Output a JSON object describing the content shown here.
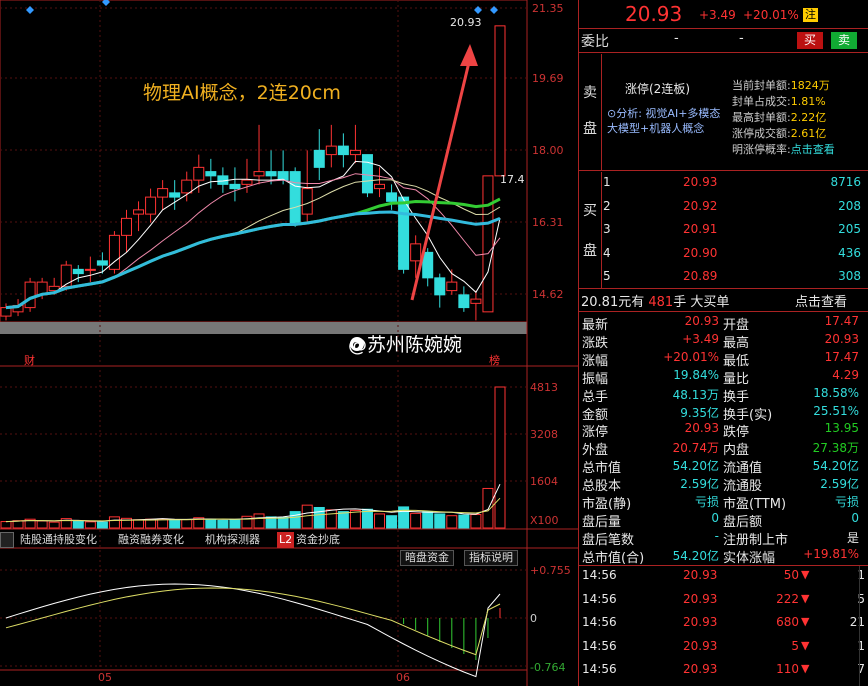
{
  "chart": {
    "price_labels": [
      "21.35",
      "19.69",
      "18.00",
      "16.31",
      "14.62"
    ],
    "high_marker": "20.93",
    "low_marker": "17.4",
    "annotation": "物理AI概念，2连20cm",
    "watermark": "@苏州陈婉婉",
    "marker_left": "财",
    "marker_right": "榜",
    "volume_labels": [
      "4813",
      "3208",
      "1604",
      "X100"
    ],
    "macd_labels": [
      "+0.755",
      "0",
      "-0.764"
    ],
    "month_labels": [
      "05",
      "06"
    ],
    "tabs": [
      "陆股通持股变化",
      "融资融券变化",
      "机构探测器",
      "资金抄底"
    ],
    "tab_badge": "L2",
    "buttons": [
      "暗盘资金",
      "指标说明"
    ],
    "colors": {
      "up": "#ff3333",
      "down": "#33dddd",
      "ma_green": "#33cc33",
      "ma_cyan": "#33bbdd",
      "ma_white": "#dddddd",
      "ma_pink": "#ee88aa"
    },
    "candles": [
      {
        "o": 14.1,
        "c": 14.3,
        "h": 14.4,
        "l": 14.0,
        "v": 220
      },
      {
        "o": 14.2,
        "c": 14.35,
        "h": 14.5,
        "l": 14.1,
        "v": 250
      },
      {
        "o": 14.3,
        "c": 14.9,
        "h": 15.0,
        "l": 14.2,
        "v": 300
      },
      {
        "o": 14.6,
        "c": 14.9,
        "h": 15.0,
        "l": 14.5,
        "v": 240
      },
      {
        "o": 14.7,
        "c": 14.8,
        "h": 15.0,
        "l": 14.6,
        "v": 200
      },
      {
        "o": 14.8,
        "c": 15.3,
        "h": 15.4,
        "l": 14.7,
        "v": 320
      },
      {
        "o": 15.2,
        "c": 15.1,
        "h": 15.3,
        "l": 14.9,
        "v": 230
      },
      {
        "o": 15.2,
        "c": 15.2,
        "h": 15.5,
        "l": 14.9,
        "v": 210
      },
      {
        "o": 15.4,
        "c": 15.3,
        "h": 15.6,
        "l": 15.1,
        "v": 200
      },
      {
        "o": 15.2,
        "c": 16.0,
        "h": 16.1,
        "l": 15.1,
        "v": 380
      },
      {
        "o": 16.0,
        "c": 16.4,
        "h": 16.6,
        "l": 15.6,
        "v": 330
      },
      {
        "o": 16.5,
        "c": 16.6,
        "h": 16.8,
        "l": 16.1,
        "v": 280
      },
      {
        "o": 16.5,
        "c": 16.9,
        "h": 17.1,
        "l": 16.3,
        "v": 300
      },
      {
        "o": 16.9,
        "c": 17.1,
        "h": 17.3,
        "l": 16.6,
        "v": 310
      },
      {
        "o": 17.0,
        "c": 16.9,
        "h": 17.3,
        "l": 16.6,
        "v": 280
      },
      {
        "o": 17.0,
        "c": 17.3,
        "h": 17.5,
        "l": 16.8,
        "v": 290
      },
      {
        "o": 17.3,
        "c": 17.6,
        "h": 17.9,
        "l": 17.0,
        "v": 350
      },
      {
        "o": 17.5,
        "c": 17.4,
        "h": 17.8,
        "l": 17.1,
        "v": 300
      },
      {
        "o": 17.4,
        "c": 17.2,
        "h": 17.6,
        "l": 17.0,
        "v": 260
      },
      {
        "o": 17.2,
        "c": 17.1,
        "h": 17.6,
        "l": 16.8,
        "v": 280
      },
      {
        "o": 17.2,
        "c": 17.3,
        "h": 17.8,
        "l": 17.0,
        "v": 400
      },
      {
        "o": 17.4,
        "c": 17.5,
        "h": 18.6,
        "l": 17.2,
        "v": 480
      },
      {
        "o": 17.5,
        "c": 17.4,
        "h": 18.0,
        "l": 17.2,
        "v": 380
      },
      {
        "o": 17.5,
        "c": 17.3,
        "h": 18.0,
        "l": 17.2,
        "v": 360
      },
      {
        "o": 17.5,
        "c": 16.3,
        "h": 17.6,
        "l": 16.2,
        "v": 560
      },
      {
        "o": 16.5,
        "c": 17.1,
        "h": 18.0,
        "l": 16.3,
        "v": 780
      },
      {
        "o": 18.0,
        "c": 17.6,
        "h": 18.5,
        "l": 17.3,
        "v": 700
      },
      {
        "o": 17.9,
        "c": 18.1,
        "h": 18.6,
        "l": 17.6,
        "v": 620
      },
      {
        "o": 18.1,
        "c": 17.9,
        "h": 18.4,
        "l": 17.6,
        "v": 560
      },
      {
        "o": 17.9,
        "c": 18.0,
        "h": 18.6,
        "l": 17.7,
        "v": 600
      },
      {
        "o": 17.9,
        "c": 17.0,
        "h": 17.9,
        "l": 16.9,
        "v": 640
      },
      {
        "o": 17.1,
        "c": 17.2,
        "h": 17.6,
        "l": 16.9,
        "v": 480
      },
      {
        "o": 17.0,
        "c": 16.8,
        "h": 17.2,
        "l": 16.6,
        "v": 420
      },
      {
        "o": 16.9,
        "c": 15.2,
        "h": 16.9,
        "l": 15.1,
        "v": 720
      },
      {
        "o": 15.4,
        "c": 15.8,
        "h": 16.0,
        "l": 15.0,
        "v": 500
      },
      {
        "o": 15.6,
        "c": 15.0,
        "h": 15.7,
        "l": 14.8,
        "v": 560
      },
      {
        "o": 15.0,
        "c": 14.6,
        "h": 15.1,
        "l": 14.3,
        "v": 480
      },
      {
        "o": 14.7,
        "c": 14.9,
        "h": 15.2,
        "l": 14.6,
        "v": 420
      },
      {
        "o": 14.6,
        "c": 14.3,
        "h": 14.8,
        "l": 14.2,
        "v": 440
      },
      {
        "o": 14.4,
        "c": 14.5,
        "h": 14.7,
        "l": 14.0,
        "v": 460
      },
      {
        "o": 14.2,
        "c": 17.4,
        "h": 17.4,
        "l": 14.2,
        "v": 1350
      },
      {
        "o": 17.4,
        "c": 20.93,
        "h": 20.93,
        "l": 17.4,
        "v": 4813
      }
    ]
  },
  "quote": {
    "price": "20.93",
    "change": "+3.49",
    "change_pct": "+20.01%",
    "tag": "注",
    "weibi_label": "委比",
    "weibi_val1": "-",
    "weibi_val2": "-",
    "buy_btn": "买",
    "sell_btn": "卖"
  },
  "sell_box": {
    "side_label": [
      "卖",
      "盘"
    ],
    "title": "涨停(2连板)",
    "analysis": "⊙分析: 视觉AI+多模态大模型+机器人概念",
    "rows": [
      {
        "label": "当前封单额:",
        "value": "1824万"
      },
      {
        "label": "封单占成交:",
        "value": "1.81%"
      },
      {
        "label": "最高封单额:",
        "value": "2.22亿"
      },
      {
        "label": "涨停成交额:",
        "value": "2.61亿"
      },
      {
        "label": "明涨停概率:",
        "value": "点击查看"
      }
    ]
  },
  "buy_book": {
    "side_label": [
      "买",
      "盘"
    ],
    "rows": [
      {
        "n": "1",
        "price": "20.93",
        "vol": "8716"
      },
      {
        "n": "2",
        "price": "20.92",
        "vol": "208"
      },
      {
        "n": "3",
        "price": "20.91",
        "vol": "205"
      },
      {
        "n": "4",
        "price": "20.90",
        "vol": "436"
      },
      {
        "n": "5",
        "price": "20.89",
        "vol": "308"
      }
    ]
  },
  "big_order": {
    "price": "20.81",
    "unit1": "元有",
    "hands": "481",
    "unit2": "手 大买单",
    "link": "点击查看"
  },
  "stats": [
    {
      "l1": "最新",
      "v1": "20.93",
      "c1": "red",
      "l2": "开盘",
      "v2": "17.47",
      "c2": "red"
    },
    {
      "l1": "涨跌",
      "v1": "+3.49",
      "c1": "red",
      "l2": "最高",
      "v2": "20.93",
      "c2": "red"
    },
    {
      "l1": "涨幅",
      "v1": "+20.01%",
      "c1": "red",
      "l2": "最低",
      "v2": "17.47",
      "c2": "red"
    },
    {
      "l1": "振幅",
      "v1": "19.84%",
      "c1": "cyan",
      "l2": "量比",
      "v2": "4.29",
      "c2": "red"
    },
    {
      "l1": "总手",
      "v1": "48.13万",
      "c1": "cyan",
      "l2": "换手",
      "v2": "18.58%",
      "c2": "cyan"
    },
    {
      "l1": "金额",
      "v1": "9.35亿",
      "c1": "cyan",
      "l2": "换手(实)",
      "v2": "25.51%",
      "c2": "cyan"
    },
    {
      "l1": "涨停",
      "v1": "20.93",
      "c1": "red",
      "l2": "跌停",
      "v2": "13.95",
      "c2": "green"
    },
    {
      "l1": "外盘",
      "v1": "20.74万",
      "c1": "red",
      "l2": "内盘",
      "v2": "27.38万",
      "c2": "green"
    },
    {
      "l1": "总市值",
      "v1": "54.20亿",
      "c1": "cyan",
      "l2": "流通值",
      "v2": "54.20亿",
      "c2": "cyan"
    },
    {
      "l1": "总股本",
      "v1": "2.59亿",
      "c1": "cyan",
      "l2": "流通股",
      "v2": "2.59亿",
      "c2": "cyan"
    },
    {
      "l1": "市盈(静)",
      "v1": "亏损",
      "c1": "cyan",
      "l2": "市盈(TTM)",
      "v2": "亏损",
      "c2": "cyan"
    },
    {
      "l1": "盘后量",
      "v1": "0",
      "c1": "cyan",
      "l2": "盘后额",
      "v2": "0",
      "c2": "cyan"
    },
    {
      "l1": "盘后笔数",
      "v1": "-",
      "c1": "cyan",
      "l2": "注册制上市",
      "v2": "是",
      "c2": "white"
    },
    {
      "l1": "总市值(合)",
      "v1": "54.20亿",
      "c1": "cyan",
      "l2": "实体涨幅",
      "v2": "+19.81%",
      "c2": "red"
    }
  ],
  "ticks": [
    {
      "time": "14:56",
      "price": "20.93",
      "vol": "50",
      "n": "1"
    },
    {
      "time": "14:56",
      "price": "20.93",
      "vol": "222",
      "n": "5"
    },
    {
      "time": "14:56",
      "price": "20.93",
      "vol": "680",
      "n": "21"
    },
    {
      "time": "14:56",
      "price": "20.93",
      "vol": "5",
      "n": "1"
    },
    {
      "time": "14:56",
      "price": "20.93",
      "vol": "110",
      "n": "7"
    }
  ]
}
